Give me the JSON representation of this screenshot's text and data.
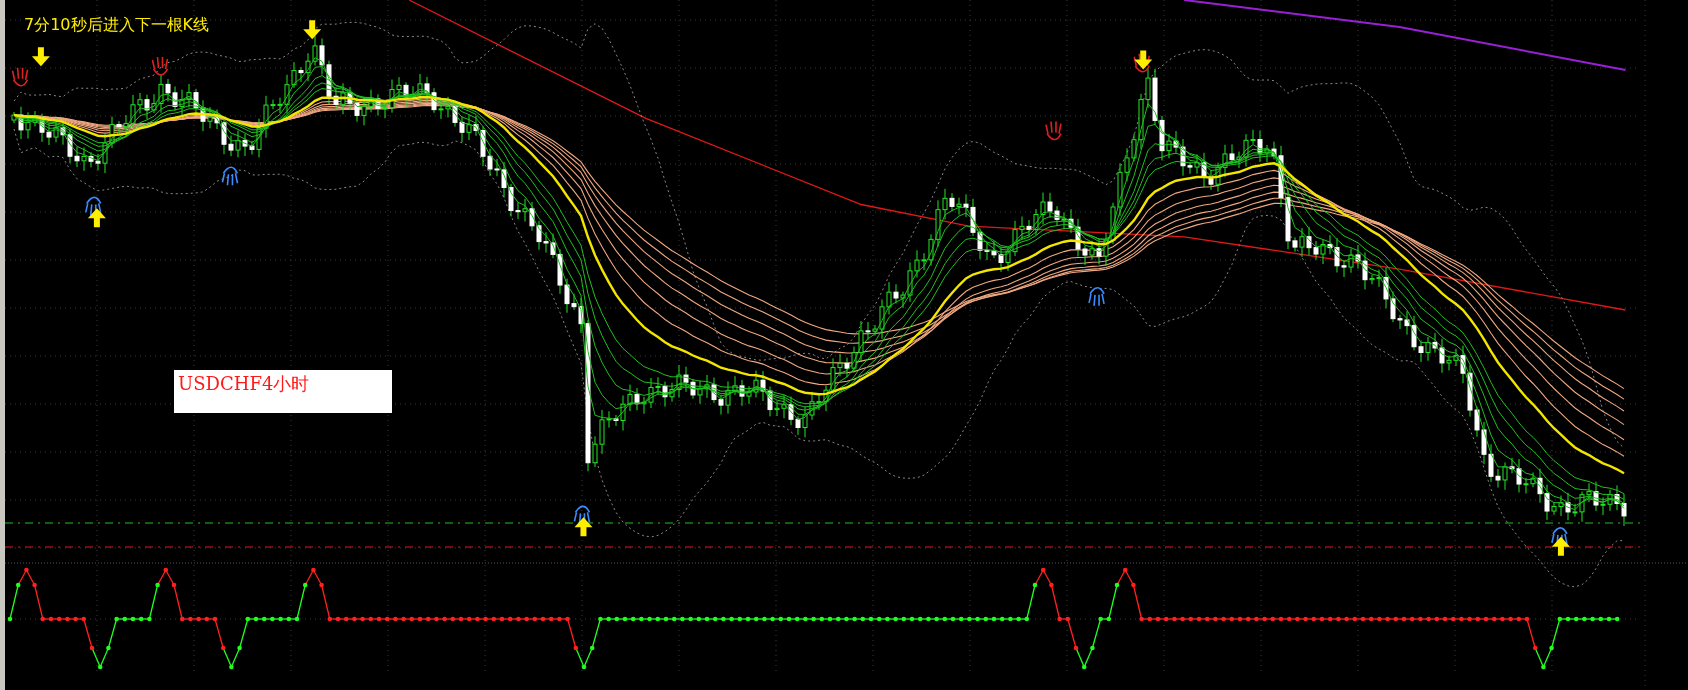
{
  "countdown": {
    "text": "7分10秒后进入下一根K线"
  },
  "symbol_label": {
    "text": "USDCHF4小时"
  }
}
